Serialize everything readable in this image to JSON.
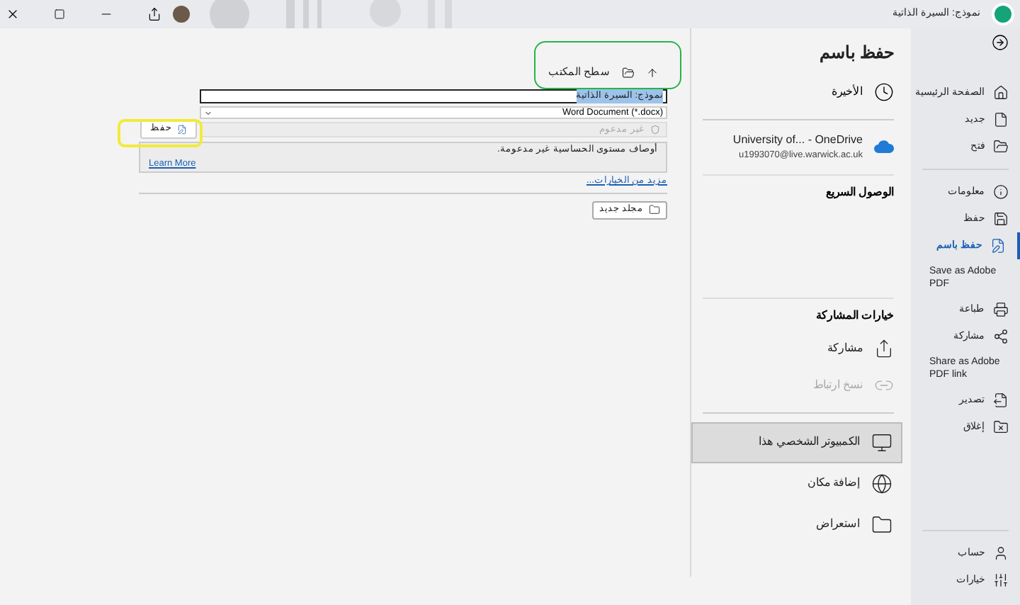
{
  "window": {
    "title": "نموذج: السيرة الذاتية"
  },
  "sidebar": {
    "top": [
      {
        "label": "الصفحة الرئيسية",
        "selected": false
      },
      {
        "label": "جديد",
        "selected": false
      },
      {
        "label": "فتح",
        "selected": false
      }
    ],
    "main": [
      {
        "label": "معلومات",
        "selected": false
      },
      {
        "label": "حفظ",
        "selected": false
      },
      {
        "label": "حفظ باسم",
        "selected": true
      },
      {
        "label": "Save as Adobe PDF",
        "selected": false
      },
      {
        "label": "طباعة",
        "selected": false
      },
      {
        "label": "مشاركة",
        "selected": false
      },
      {
        "label": "Share as Adobe PDF link",
        "selected": false
      },
      {
        "label": "تصدير",
        "selected": false
      },
      {
        "label": "إغلاق",
        "selected": false
      }
    ],
    "bottom": [
      {
        "label": "حساب",
        "selected": false
      },
      {
        "label": "خيارات",
        "selected": false
      }
    ]
  },
  "places": {
    "title": "حفظ باسم",
    "recent": {
      "label": "الأخيرة"
    },
    "onedrive": {
      "name": "University of... - OneDrive",
      "email": "u1993070@live.warwick.ac.uk"
    },
    "quick_access": "الوصول السريع",
    "sharing_title": "خيارات المشاركة",
    "sharing": [
      {
        "label": "مشاركة",
        "disabled": false
      },
      {
        "label": "نسخ ارتباط",
        "disabled": true
      }
    ],
    "locations": [
      {
        "label": "الكمبيوتر الشخصي هذا",
        "selected": true
      },
      {
        "label": "إضافة مكان",
        "selected": false
      },
      {
        "label": "استعراض",
        "selected": false
      }
    ]
  },
  "save_panel": {
    "path": "سطح المكتب",
    "file_name": "نموذج: السيرة الذاتية",
    "file_type": "Word Document (*.docx)",
    "sensitivity": "غير مدعوم",
    "save_button": "حفظ",
    "warning": "أوصاف مستوى الحساسية غير مدعومة.",
    "learn_more": "Learn More",
    "more_options": "مزيد من الخيارات...",
    "new_folder": "مجلد جديد"
  }
}
